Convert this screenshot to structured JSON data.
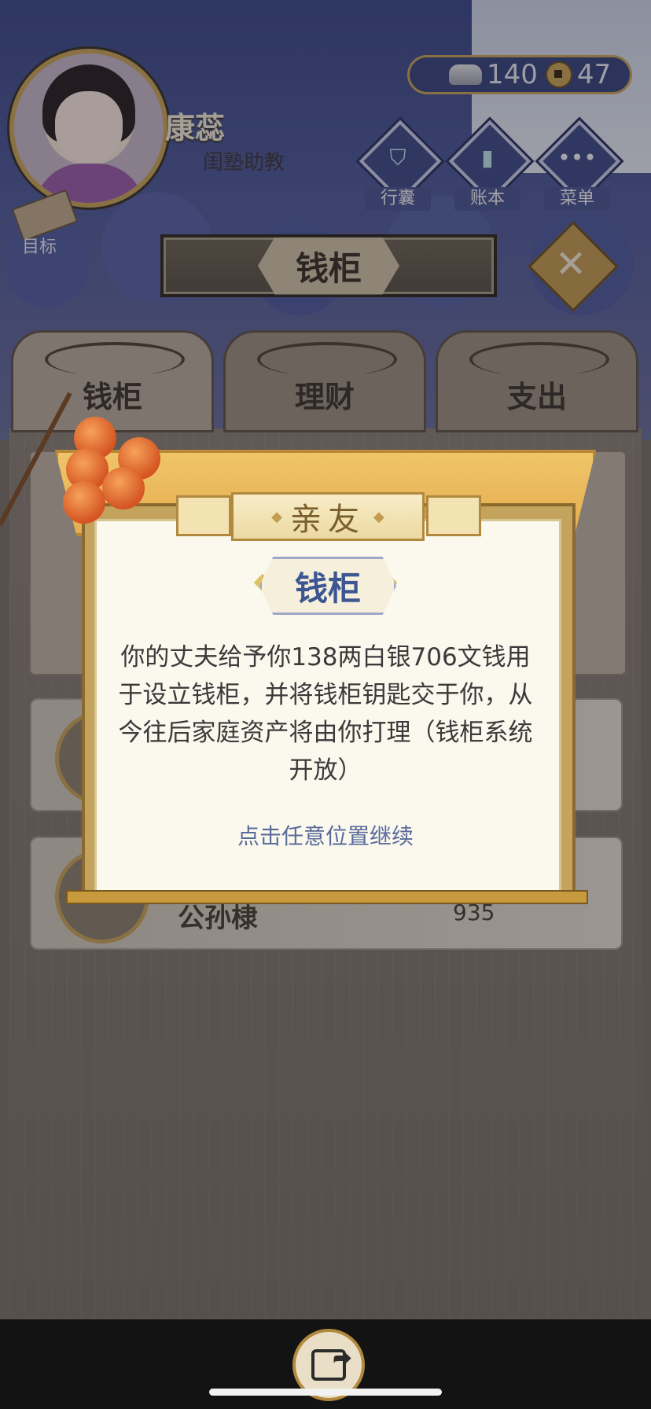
{
  "header": {
    "name": "康蕊",
    "title": "闺塾助教",
    "silver": "140",
    "coins": "47",
    "target_label": "目标",
    "buttons": [
      {
        "label": "行囊",
        "icon": "bag-icon"
      },
      {
        "label": "账本",
        "icon": "ledger-icon"
      },
      {
        "label": "菜单",
        "icon": "menu-icon"
      }
    ]
  },
  "page": {
    "title": "钱柜",
    "close": "✕"
  },
  "tabs": [
    {
      "label": "钱柜",
      "active": true
    },
    {
      "label": "理财",
      "active": false
    },
    {
      "label": "支出",
      "active": false
    }
  ],
  "background_rows": [
    {
      "name": "",
      "amount": ""
    },
    {
      "name": "公孙棣",
      "amount": "935"
    }
  ],
  "modal": {
    "category": "亲友",
    "tag": "钱柜",
    "message": "你的丈夫给予你138两白银706文钱用于设立钱柜，并将钱柜钥匙交于你，从今往后家庭资产将由你打理（钱柜系统开放）",
    "continue": "点击任意位置继续"
  },
  "colors": {
    "accent_gold": "#c9a55a",
    "navy": "#3b477e",
    "modal_text_blue": "#3d5692"
  }
}
